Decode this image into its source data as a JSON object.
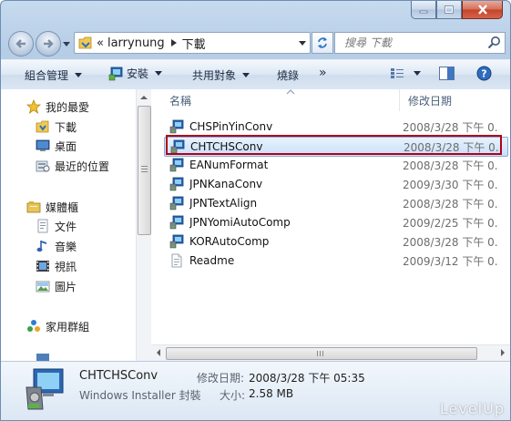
{
  "address": {
    "overflow": "«",
    "segments": [
      "larrynung",
      "下載"
    ]
  },
  "search": {
    "placeholder": "搜尋 下載"
  },
  "toolbar": {
    "organize": "組合管理",
    "install": "安裝",
    "share": "共用對象",
    "burn": "燒錄",
    "more": "»"
  },
  "nav": {
    "favorites": {
      "label": "我的最愛",
      "items": [
        "下載",
        "桌面",
        "最近的位置"
      ]
    },
    "libraries": {
      "label": "媒體櫃",
      "items": [
        "文件",
        "音樂",
        "視訊",
        "圖片"
      ]
    },
    "homegroup": "家用群組"
  },
  "columns": {
    "name": "名稱",
    "date": "修改日期"
  },
  "files": [
    {
      "name": "CHSPinYinConv",
      "date": "2008/3/28 下午 0...",
      "icon": "installer-icon"
    },
    {
      "name": "CHTCHSConv",
      "date": "2008/3/28 下午 0...",
      "icon": "installer-icon",
      "selected": true
    },
    {
      "name": "EANumFormat",
      "date": "2008/3/28 下午 0...",
      "icon": "installer-icon"
    },
    {
      "name": "JPNKanaConv",
      "date": "2009/3/30 下午 0...",
      "icon": "installer-icon"
    },
    {
      "name": "JPNTextAlign",
      "date": "2008/3/28 下午 0...",
      "icon": "installer-icon"
    },
    {
      "name": "JPNYomiAutoComp",
      "date": "2009/2/25 下午 0...",
      "icon": "installer-icon"
    },
    {
      "name": "KORAutoComp",
      "date": "2008/3/28 下午 0...",
      "icon": "installer-icon"
    },
    {
      "name": "Readme",
      "date": "2009/3/12 下午 0...",
      "icon": "text-file-icon"
    }
  ],
  "details": {
    "name": "CHTCHSConv",
    "type": "Windows Installer 封裝",
    "modified_label": "修改日期:",
    "modified_value": "2008/3/28 下午 05:35",
    "size_label": "大小:",
    "size_value": "2.58 MB"
  },
  "watermark": "LevelUp",
  "colors": {
    "selection_outline": "#b30015",
    "window_frame": "#b9d0e8"
  }
}
